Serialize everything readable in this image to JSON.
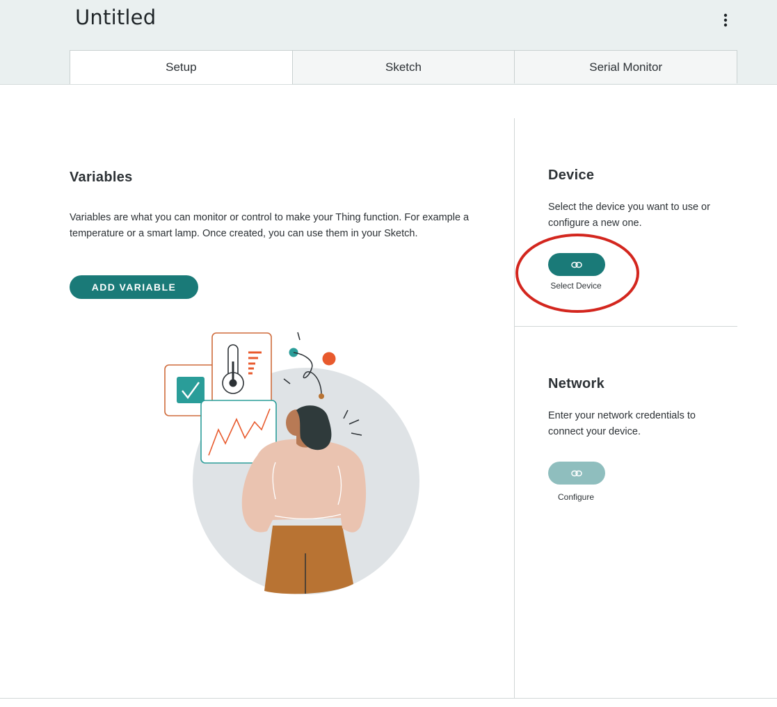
{
  "header": {
    "title": "Untitled",
    "more_icon": "vertical-ellipsis-icon"
  },
  "tabs": [
    {
      "label": "Setup",
      "active": true
    },
    {
      "label": "Sketch",
      "active": false
    },
    {
      "label": "Serial Monitor",
      "active": false
    }
  ],
  "variables": {
    "heading": "Variables",
    "description_line1": "Variables are what you can monitor or control to make your Thing function. For example a",
    "description_line2": "temperature or a smart lamp. Once created, you can use them in your Sketch.",
    "add_button": "ADD VARIABLE"
  },
  "device": {
    "heading": "Device",
    "description_line1": "Select the device you want to use or",
    "description_line2": "configure a new one.",
    "button_icon": "link-icon",
    "button_caption": "Select Device"
  },
  "network": {
    "heading": "Network",
    "description_line1": "Enter your network credentials to",
    "description_line2": "connect your device.",
    "button_icon": "link-icon",
    "button_caption": "Configure"
  },
  "colors": {
    "accent": "#1a7a78",
    "accent_disabled": "#8fbebe",
    "header_bg": "#eaf0f0",
    "annotation": "#d3261e"
  }
}
